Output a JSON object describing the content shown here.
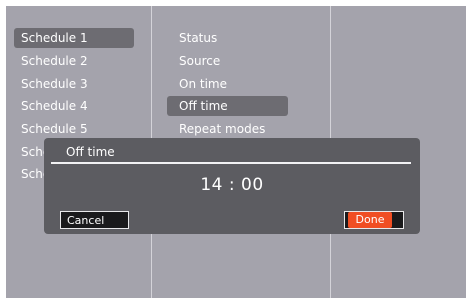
{
  "colors": {
    "background": "#a4a3ac",
    "selection": "#6d6c72",
    "dialog": "#5c5c61",
    "done_accent": "#f04e23",
    "text": "#ffffff"
  },
  "schedules": {
    "items": [
      {
        "label": "Schedule 1",
        "selected": true
      },
      {
        "label": "Schedule 2"
      },
      {
        "label": "Schedule 3"
      },
      {
        "label": "Schedule 4"
      },
      {
        "label": "Schedule 5"
      },
      {
        "label": "Sche"
      },
      {
        "label": "Sche"
      }
    ]
  },
  "settings": {
    "items": [
      {
        "label": "Status"
      },
      {
        "label": "Source"
      },
      {
        "label": "On time"
      },
      {
        "label": "Off time",
        "selected": true
      },
      {
        "label": "Repeat modes"
      }
    ]
  },
  "dialog": {
    "title": "Off time",
    "time": "14 : 00",
    "cancel_label": "Cancel",
    "done_label": "Done"
  }
}
